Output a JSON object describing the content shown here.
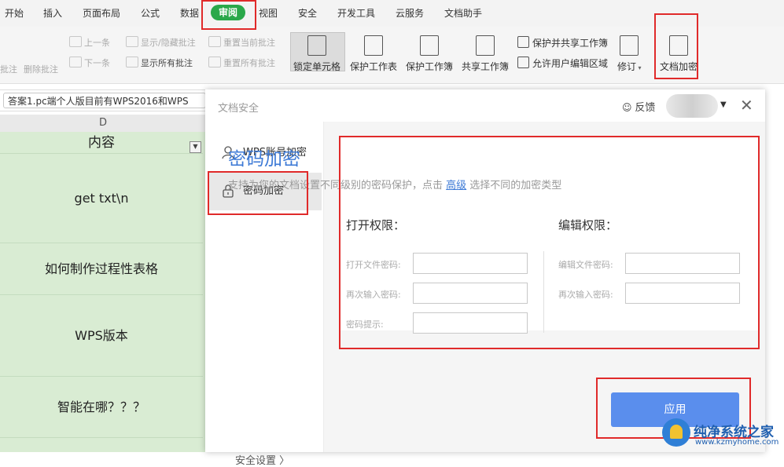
{
  "menu": {
    "items": [
      "开始",
      "插入",
      "页面布局",
      "公式",
      "数据"
    ],
    "active": "审阅",
    "items_after": [
      "视图",
      "安全",
      "开发工具",
      "云服务",
      "文档助手"
    ]
  },
  "ribbon": {
    "comment_group": {
      "partial_left_1": "批注",
      "partial_left_2": "批注",
      "delete": "删除批注",
      "prev": "上一条",
      "next": "下一条",
      "show_hide": "显示/隐藏批注",
      "show_all": "显示所有批注",
      "reset_current": "重置当前批注",
      "reset_all": "重置所有批注"
    },
    "lock_cell": "锁定单元格",
    "protect_sheet": "保护工作表",
    "protect_workbook": "保护工作簿",
    "share_workbook": "共享工作簿",
    "protect_share": "保护并共享工作簿",
    "allow_edit": "允许用户编辑区域",
    "revise": "修订",
    "doc_encrypt": "文档加密"
  },
  "formula_bar": {
    "text": "答案1.pc端个人版目前有WPS2016和WPS"
  },
  "sheet": {
    "column": "D",
    "header": "内容",
    "rows": [
      "get txt\\n",
      "如何制作过程性表格",
      "WPS版本",
      "智能在哪？？？"
    ]
  },
  "dialog": {
    "title": "文档安全",
    "feedback": "反馈",
    "side": {
      "items": [
        "WPS账号加密",
        "密码加密"
      ],
      "settings": "安全设置 〉"
    },
    "content": {
      "title": "密码加密",
      "desc_before": "支持为您的文档设置不同级别的密码保护，点击 ",
      "desc_link": "高级",
      "desc_after": " 选择不同的加密类型",
      "open_section": "打开权限：",
      "edit_section": "编辑权限：",
      "open_password": "打开文件密码:",
      "open_repeat": "再次输入密码:",
      "hint": "密码提示:",
      "edit_password": "编辑文件密码:",
      "edit_repeat": "再次输入密码:",
      "apply": "应用"
    }
  },
  "watermark": {
    "name": "纯净系统之家",
    "url": "www.kzmyhome.com"
  },
  "colors": {
    "accent": "#3d7ad6",
    "button": "#5a8eed",
    "active_tab": "#2aa84a",
    "highlight_box": "#e02a2a",
    "sheet_fill": "#d9ecd3"
  }
}
